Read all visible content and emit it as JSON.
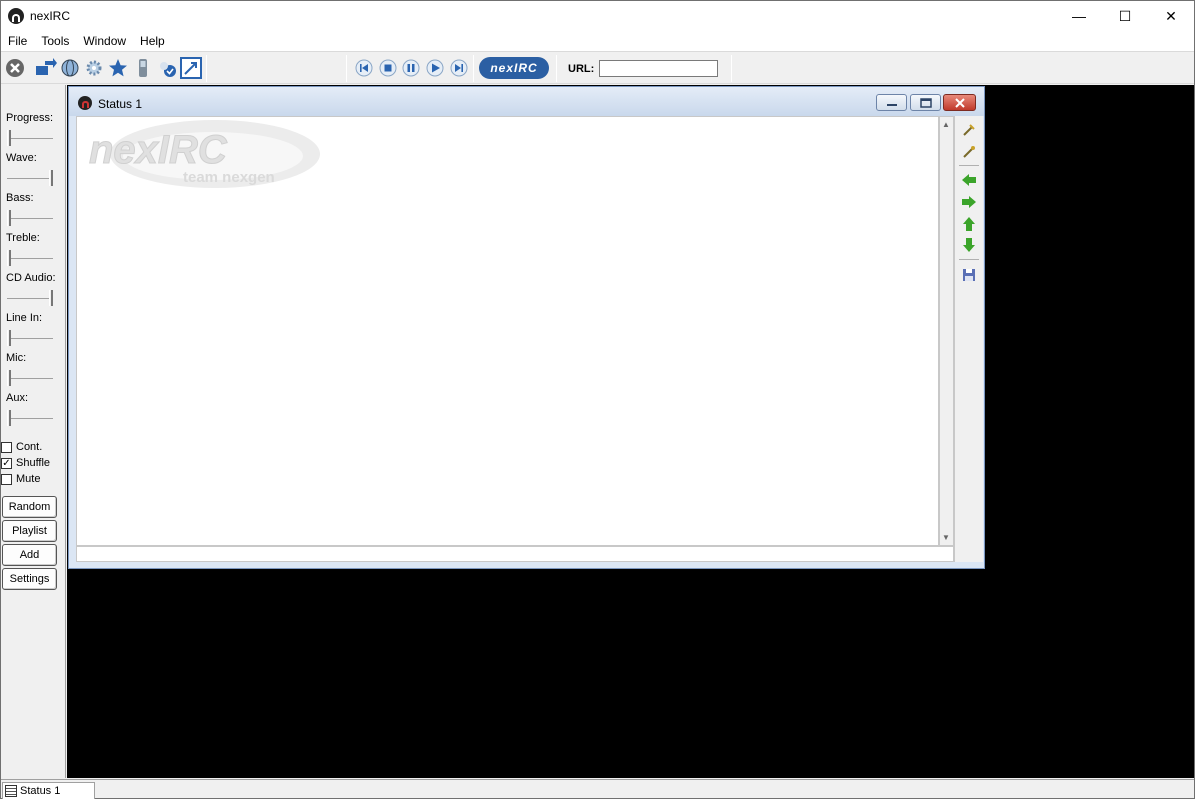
{
  "app": {
    "title": "nexIRC"
  },
  "window_controls": {
    "minimize": "—",
    "maximize": "☐",
    "close": "✕"
  },
  "menu": [
    "File",
    "Tools",
    "Window",
    "Help"
  ],
  "toolbar": {
    "logo_text": "nexIRC",
    "url_label": "URL:",
    "url_value": ""
  },
  "side_panel": {
    "sliders": [
      {
        "label": "Progress:",
        "level": 0.0
      },
      {
        "label": "Wave:",
        "level": 1.0
      },
      {
        "label": "Bass:",
        "level": 0.0
      },
      {
        "label": "Treble:",
        "level": 0.0
      },
      {
        "label": "CD Audio:",
        "level": 1.0
      },
      {
        "label": "Line In:",
        "level": 0.0
      },
      {
        "label": "Mic:",
        "level": 0.0
      },
      {
        "label": "Aux:",
        "level": 0.0
      }
    ],
    "checkboxes": [
      {
        "label": "Cont.",
        "checked": false
      },
      {
        "label": "Shuffle",
        "checked": true
      },
      {
        "label": "Mute",
        "checked": false
      }
    ],
    "buttons": [
      "Random",
      "Playlist",
      "Add",
      "Settings"
    ]
  },
  "status_window": {
    "title": "Status 1",
    "watermark_logo": "nexIRC",
    "watermark_tagline": "team nexgen"
  },
  "taskbar": {
    "tab_label": "Status 1"
  },
  "colors": {
    "accent": "#2b5fa3",
    "mdi_background": "#000000",
    "window_frame": "#dbe6f4"
  }
}
